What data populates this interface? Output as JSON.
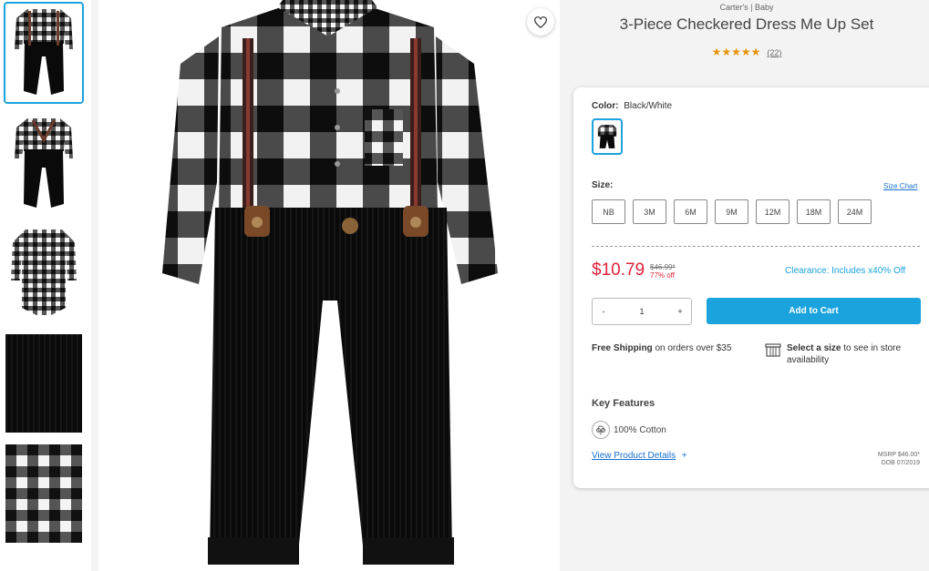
{
  "product": {
    "brand": "Carter's | Baby",
    "title": "3-Piece Checkered Dress Me Up Set",
    "stars": "★★★★★",
    "review_count": "(22)",
    "rating": 5
  },
  "color": {
    "label": "Color:",
    "value": "Black/White"
  },
  "size": {
    "label": "Size:",
    "chart_link": "Size Chart",
    "options": [
      "NB",
      "3M",
      "6M",
      "9M",
      "12M",
      "18M",
      "24M"
    ]
  },
  "pricing": {
    "price": "$10.79",
    "original": "$46.99*",
    "discount": "77% off",
    "clearance": "Clearance: Includes x40% Off"
  },
  "quantity": {
    "minus": "-",
    "value": "1",
    "plus": "+"
  },
  "cart": {
    "label": "Add to Cart"
  },
  "shipping": {
    "bold": "Free Shipping",
    "rest": " on orders over $35"
  },
  "store": {
    "bold": "Select a size",
    "rest": " to see in store availability"
  },
  "features": {
    "title": "Key Features",
    "cotton": "100% Cotton"
  },
  "details": {
    "link": "View Product Details",
    "plus": "+"
  },
  "msrp": {
    "line1": "MSRP $46.00*",
    "line2": "DOB 07/2019"
  },
  "colors": {
    "accent": "#1aa3dc",
    "price": "#e0223a",
    "star": "#e8920c"
  },
  "icons": [
    "heart-icon",
    "cotton-icon",
    "store-icon"
  ]
}
